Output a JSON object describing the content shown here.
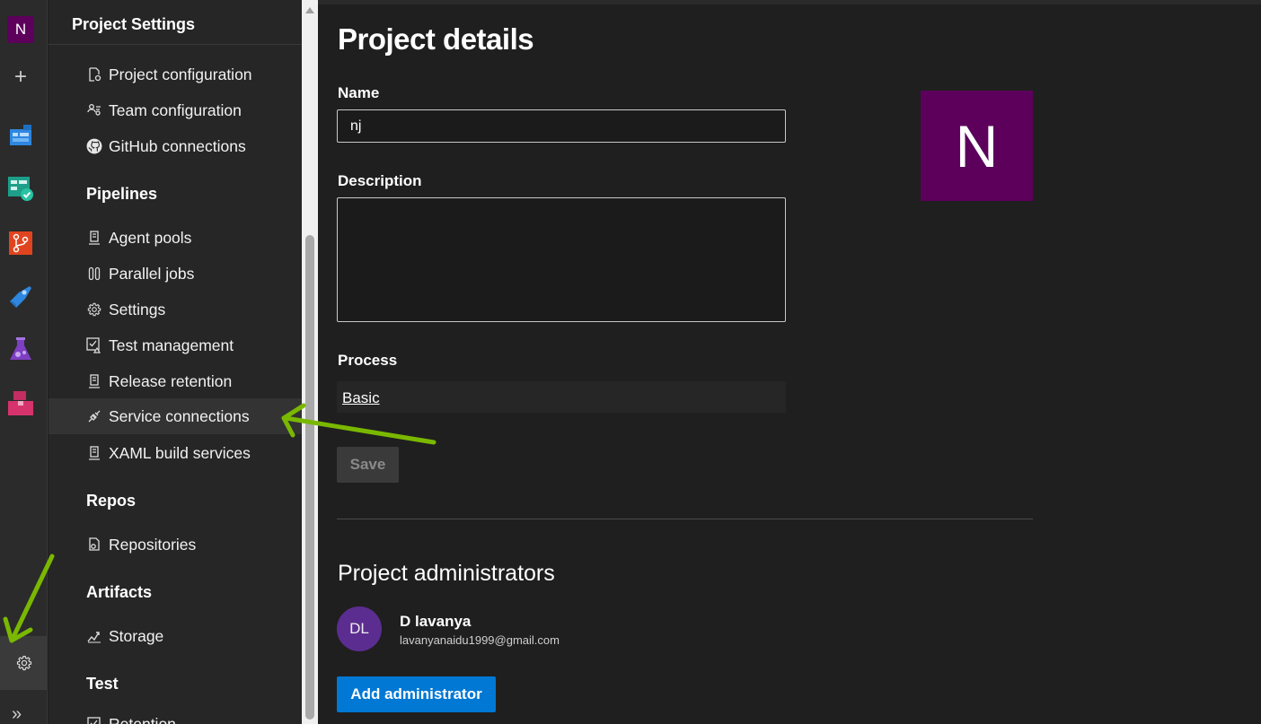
{
  "rail": {
    "org_initial": "N",
    "services": [
      "overview-icon",
      "boards-icon",
      "repos-icon",
      "pipelines-icon",
      "test-plans-icon",
      "artifacts-icon"
    ],
    "settings_icon": "gear-icon",
    "expand_label": "»"
  },
  "nav": {
    "header": "Project Settings",
    "boards_items": [
      {
        "label": "Project configuration",
        "icon": "project-config-icon"
      },
      {
        "label": "Team configuration",
        "icon": "team-config-icon"
      },
      {
        "label": "GitHub connections",
        "icon": "github-icon"
      }
    ],
    "pipelines": {
      "title": "Pipelines",
      "items": [
        {
          "label": "Agent pools",
          "icon": "agent-pools-icon"
        },
        {
          "label": "Parallel jobs",
          "icon": "parallel-jobs-icon"
        },
        {
          "label": "Settings",
          "icon": "gear-icon"
        },
        {
          "label": "Test management",
          "icon": "test-management-icon"
        },
        {
          "label": "Release retention",
          "icon": "release-retention-icon"
        },
        {
          "label": "Service connections",
          "icon": "service-connections-icon"
        },
        {
          "label": "XAML build services",
          "icon": "xaml-build-icon"
        }
      ]
    },
    "repos": {
      "title": "Repos",
      "items": [
        {
          "label": "Repositories",
          "icon": "repositories-icon"
        }
      ]
    },
    "artifacts": {
      "title": "Artifacts",
      "items": [
        {
          "label": "Storage",
          "icon": "storage-icon"
        }
      ]
    },
    "test": {
      "title": "Test",
      "items": [
        {
          "label": "Retention",
          "icon": "retention-icon"
        }
      ]
    }
  },
  "main": {
    "title": "Project details",
    "name_label": "Name",
    "name_value": "nj",
    "description_label": "Description",
    "description_value": "",
    "process_label": "Process",
    "process_value": "Basic",
    "save_label": "Save",
    "project_avatar_initial": "N",
    "admins_title": "Project administrators",
    "admin": {
      "initials": "DL",
      "name": "D lavanya",
      "email": "lavanyanaidu1999@gmail.com"
    },
    "add_admin_label": "Add administrator"
  },
  "colors": {
    "project_accent": "#5c005c",
    "primary_button": "#0078d4",
    "admin_avatar": "#5c2d91",
    "annotation_arrow": "#7ab800"
  }
}
